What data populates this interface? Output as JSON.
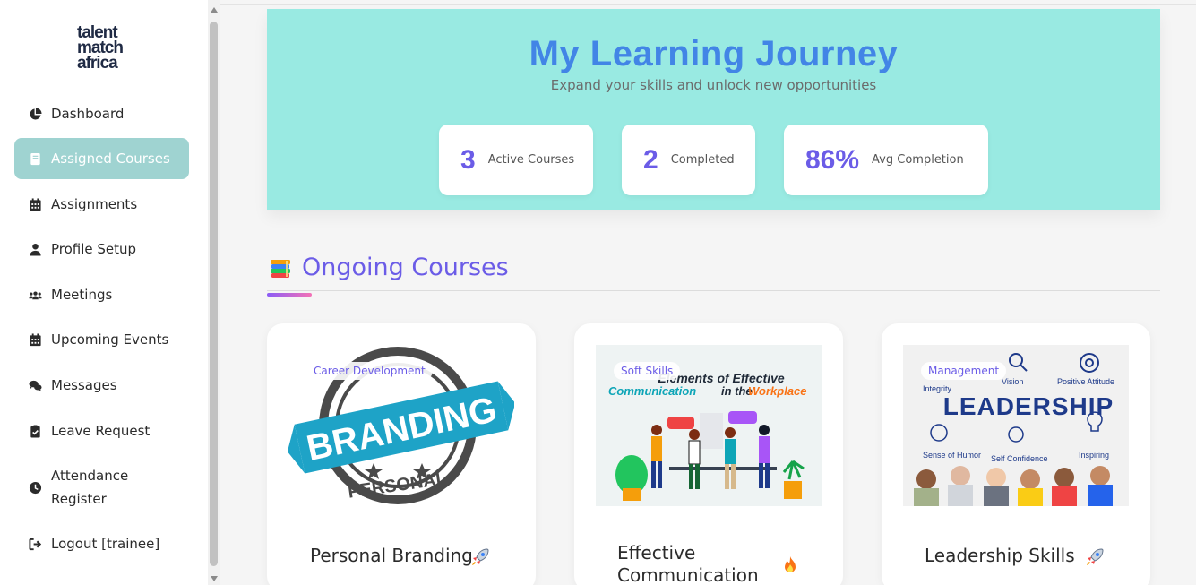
{
  "brand": {
    "logo_lines": [
      "talent",
      "match",
      "africa"
    ]
  },
  "sidebar": {
    "items": [
      {
        "label": "Dashboard",
        "icon": "pie-chart-icon"
      },
      {
        "label": "Assigned Courses",
        "icon": "book-icon",
        "active": true
      },
      {
        "label": "Assignments",
        "icon": "calendar-icon"
      },
      {
        "label": "Profile Setup",
        "icon": "user-icon"
      },
      {
        "label": "Meetings",
        "icon": "users-icon"
      },
      {
        "label": "Upcoming Events",
        "icon": "calendar-icon"
      },
      {
        "label": "Messages",
        "icon": "comments-icon"
      },
      {
        "label": "Leave Request",
        "icon": "clipboard-check-icon"
      },
      {
        "label": "Attendance Register",
        "icon": "clock-icon"
      },
      {
        "label": "Logout [trainee]",
        "icon": "sign-out-icon"
      }
    ]
  },
  "hero": {
    "title": "My Learning Journey",
    "subtitle": "Expand your skills and unlock new opportunities",
    "stats": [
      {
        "value": "3",
        "label": "Active Courses"
      },
      {
        "value": "2",
        "label": "Completed"
      },
      {
        "value": "86%",
        "label": "Avg Completion"
      }
    ]
  },
  "ongoing": {
    "title": "Ongoing Courses",
    "icon": "books-icon",
    "courses": [
      {
        "category": "Career Development",
        "title": "Personal Branding",
        "emoji": "rocket-icon",
        "image_text": [
          "PERSONAL",
          "BRANDING"
        ]
      },
      {
        "category": "Soft Skills",
        "title": "Effective Communication",
        "emoji": "fire-icon",
        "image_text": [
          "Elements of Effective",
          "Communication",
          "in the",
          "Workplace"
        ]
      },
      {
        "category": "Management",
        "title": "Leadership Skills",
        "emoji": "rocket-icon",
        "image_text": [
          "LEADERSHIP",
          "Vision",
          "Positive Attitude",
          "Integrity",
          "Sense of Humor",
          "Self Confidence",
          "Inspiring"
        ]
      }
    ]
  },
  "colors": {
    "accent": "#6b5ce7",
    "hero_bg": "#99eae2",
    "active_nav": "#9fd3d1",
    "title_blue": "#4285e6"
  }
}
